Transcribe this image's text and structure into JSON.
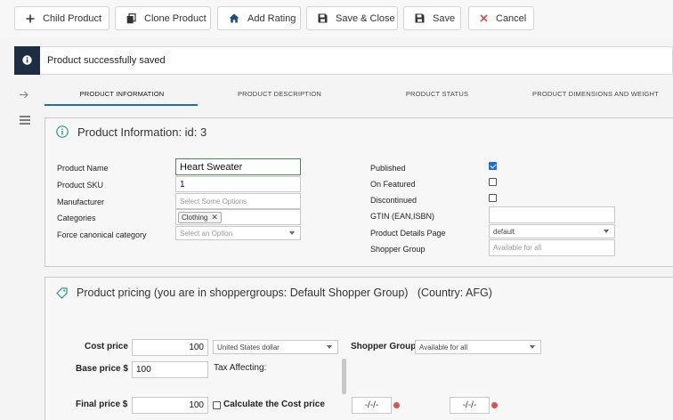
{
  "toolbar": {
    "child_product": "Child Product",
    "clone_product": "Clone Product",
    "add_rating": "Add Rating",
    "save_close": "Save & Close",
    "save": "Save",
    "cancel": "Cancel"
  },
  "message": {
    "text": "Product successfully saved"
  },
  "tabs": [
    {
      "label": "PRODUCT INFORMATION",
      "active": true
    },
    {
      "label": "PRODUCT DESCRIPTION"
    },
    {
      "label": "PRODUCT STATUS"
    },
    {
      "label": "PRODUCT DIMENSIONS AND WEIGHT"
    }
  ],
  "product_info": {
    "title": "Product Information: id: 3",
    "fields": {
      "product_name": {
        "label": "Product Name",
        "value": "Heart Sweater"
      },
      "product_sku": {
        "label": "Product SKU",
        "value": "1"
      },
      "manufacturer": {
        "label": "Manufacturer",
        "placeholder": "Select Some Options"
      },
      "categories": {
        "label": "Categories",
        "tags": [
          "Clothing"
        ]
      },
      "canonical": {
        "label": "Force canonical category",
        "placeholder": "Select an Option"
      },
      "published": {
        "label": "Published",
        "checked": true
      },
      "on_featured": {
        "label": "On Featured",
        "checked": false
      },
      "discontinued": {
        "label": "Discontinued",
        "checked": false
      },
      "gtin": {
        "label": "GTIN (EAN,ISBN)",
        "value": ""
      },
      "details_page": {
        "label": "Product Details Page",
        "value": "default"
      },
      "shopper_group": {
        "label": "Shopper Group",
        "placeholder": "Available for all"
      }
    }
  },
  "pricing": {
    "title": "Product pricing (you are in shoppergroups: Default Shopper Group)",
    "country": "(Country: AFG)",
    "cost_price": {
      "label": "Cost price",
      "value": "100",
      "currency": "United States dollar"
    },
    "shopper_group": {
      "label": "Shopper Group",
      "value": "Available for all"
    },
    "base_price": {
      "label": "Base price $",
      "value": "100"
    },
    "tax_affecting": "Tax Affecting:",
    "final_price": {
      "label": "Final price $",
      "value": "100"
    },
    "calculate_cost": {
      "label": "Calculate the Cost price",
      "checked": false
    },
    "date_from": "-/-/-",
    "date_to": "-/-/-"
  },
  "colors": {
    "accent": "#1f6fa8",
    "message_strip": "#1d2d44",
    "published_check": "#1a6fe0",
    "cancel_icon": "#d9534f"
  },
  "icons": {
    "child_product": "plus-icon",
    "clone_product": "copy-icon",
    "add_rating": "home-icon",
    "save_close": "floppy-icon",
    "save": "floppy-icon",
    "cancel": "x-icon",
    "message": "info-icon",
    "rail_arrow": "arrow-right-icon",
    "rail_menu": "hamburger-icon",
    "product_info": "info-circle-icon",
    "pricing": "tag-icon",
    "date_clear": "red-dot-icon"
  }
}
